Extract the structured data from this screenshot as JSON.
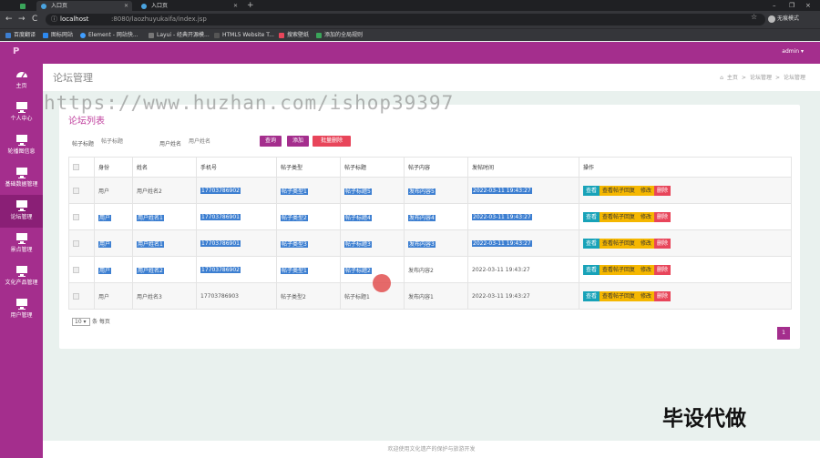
{
  "browser": {
    "tabs": [
      {
        "title": "入口页"
      },
      {
        "title": "入口页"
      }
    ],
    "new_tab": "+",
    "nav": {
      "back": "←",
      "forward": "→",
      "reload": "C"
    },
    "url_host": "localhost",
    "url_path": ":8080/laozhuyukaifa/index.jsp",
    "profile_label": "无痕模式",
    "bookmarks": [
      "百度翻译",
      "图标网站",
      "Element - 网站快...",
      "Layui - 经典开源模...",
      "HTML5 Website T...",
      "搜索壁纸",
      "添加的全局规则"
    ],
    "window_controls": [
      "–",
      "❐",
      "×"
    ]
  },
  "app": {
    "logo": "P",
    "user_menu": "admin ▾",
    "sidebar": [
      {
        "label": "主页",
        "icon": "dashboard-icon"
      },
      {
        "label": "个人中心",
        "icon": "monitor-icon"
      },
      {
        "label": "轮播图信息",
        "icon": "monitor-icon"
      },
      {
        "label": "基础数据管理",
        "icon": "monitor-icon"
      },
      {
        "label": "论坛管理",
        "icon": "monitor-icon"
      },
      {
        "label": "景点管理",
        "icon": "monitor-icon"
      },
      {
        "label": "文化产品管理",
        "icon": "monitor-icon"
      },
      {
        "label": "用户管理",
        "icon": "monitor-icon"
      }
    ],
    "page_title": "论坛管理",
    "breadcrumb": [
      "主页",
      ">",
      "论坛管理",
      ">",
      "论坛管理"
    ],
    "card_title": "论坛列表",
    "filters": {
      "label1": "帖子标题",
      "placeholder1": "帖子标题",
      "label2": "用户姓名",
      "placeholder2": "用户姓名",
      "search_btn": "查询",
      "add_btn": "添加",
      "batch_delete_btn": "批量删除"
    },
    "table": {
      "headers": [
        "身份",
        "姓名",
        "手机号",
        "帖子类型",
        "帖子标题",
        "帖子内容",
        "发帖时间",
        "操作"
      ],
      "rows": [
        {
          "role": "用户",
          "name": "用户姓名2",
          "phone": "17703786902",
          "type": "帖子类型1",
          "title": "帖子标题5",
          "content": "发布内容5",
          "time": "2022-03-11 19:43:27"
        },
        {
          "role": "用户",
          "name": "用户姓名1",
          "phone": "17703786901",
          "type": "帖子类型2",
          "title": "帖子标题4",
          "content": "发布内容4",
          "time": "2022-03-11 19:43:27"
        },
        {
          "role": "用户",
          "name": "用户姓名1",
          "phone": "17703786901",
          "type": "帖子类型3",
          "title": "帖子标题3",
          "content": "发布内容3",
          "time": "2022-03-11 19:43:27"
        },
        {
          "role": "用户",
          "name": "用户姓名2",
          "phone": "17703786902",
          "type": "帖子类型1",
          "title": "帖子标题2",
          "content": "发布内容2",
          "time": "2022-03-11 19:43:27"
        },
        {
          "role": "用户",
          "name": "用户姓名3",
          "phone": "17703786903",
          "type": "帖子类型2",
          "title": "帖子标题1",
          "content": "发布内容1",
          "time": "2022-03-11 19:43:27"
        }
      ],
      "actions": {
        "view": "查看",
        "view_reply": "查看帖子回复",
        "edit": "修改",
        "delete": "删除"
      }
    },
    "page_size": "10",
    "page_size_suffix": "条 每页",
    "current_page": "1",
    "footer": "欢迎使用文化遗产的保护与旅游开发"
  },
  "overlay": {
    "watermark": "https://www.huzhan.com/ishop39397",
    "stamp": "毕设代做"
  },
  "colors": {
    "brand": "#a42e8d",
    "danger": "#e8455a",
    "info": "#17a2b8",
    "warning": "#f5b700",
    "selection": "#3d7fd1"
  }
}
